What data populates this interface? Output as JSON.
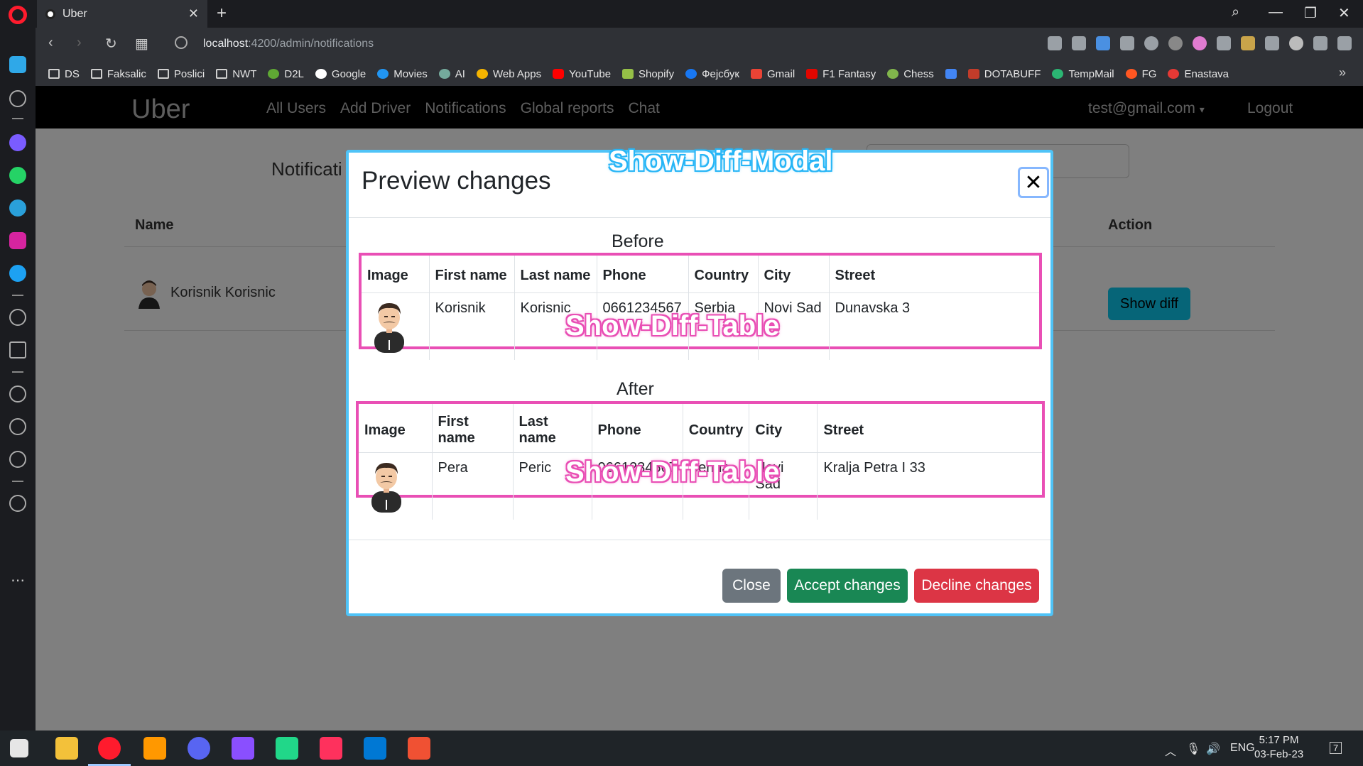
{
  "browser": {
    "tab_title": "Uber",
    "url_host": "localhost",
    "url_path": ":4200/admin/notifications",
    "bookmarks": [
      "DS",
      "Faksalic",
      "Poslici",
      "NWT",
      "D2L",
      "Google",
      "Movies",
      "AI",
      "Web Apps",
      "YouTube",
      "Shopify",
      "Фејсбук",
      "Gmail",
      "F1 Fantasy",
      "Chess",
      "DOTABUFF",
      "TempMail",
      "FG",
      "Enastava"
    ]
  },
  "navbar": {
    "brand": "Uber",
    "links": [
      "All Users",
      "Add Driver",
      "Notifications",
      "Global reports",
      "Chat"
    ],
    "user": "test@gmail.com",
    "logout": "Logout"
  },
  "page": {
    "title": "Notificati",
    "col_name": "Name",
    "col_action": "Action",
    "row_name": "Korisnik Korisnic",
    "show_diff": "Show diff"
  },
  "modal": {
    "title": "Preview changes",
    "overlay_label_modal": "Show-Diff-Modal",
    "overlay_label_table": "Show-Diff-Table",
    "before_heading": "Before",
    "after_heading": "After",
    "headers": [
      "Image",
      "First name",
      "Last name",
      "Phone",
      "Country",
      "City",
      "Street"
    ],
    "before": {
      "first": "Korisnik",
      "last": "Korisnic",
      "phone": "0661234567",
      "country": "Serbia",
      "city": "Novi Sad",
      "street": "Dunavska 3"
    },
    "after": {
      "first": "Pera",
      "last": "Peric",
      "phone": "0661234567",
      "country": "Serbia",
      "city": "Novi Sad",
      "street": "Kralja Petra I 33"
    },
    "buttons": {
      "close": "Close",
      "accept": "Accept changes",
      "decline": "Decline changes"
    }
  },
  "taskbar": {
    "lang": "ENG",
    "time": "5:17 PM",
    "date": "03-Feb-23",
    "notif_count": "7"
  },
  "colors": {
    "accept": "#198754",
    "decline": "#dc3545",
    "close": "#6c757d",
    "show_diff": "#0dcaf0",
    "annotation_pink": "#e94fb5",
    "annotation_blue": "#29b6f6"
  }
}
